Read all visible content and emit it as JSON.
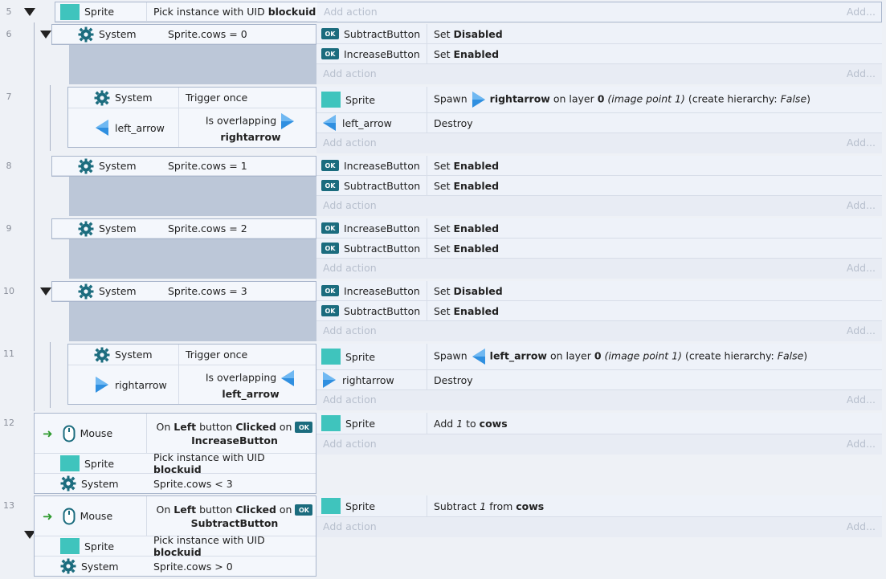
{
  "strings": {
    "add_action": "Add action",
    "add": "Add...",
    "sprite": "Sprite",
    "system": "System",
    "mouse": "Mouse",
    "left_arrow": "left_arrow",
    "rightarrow": "rightarrow",
    "subtract_button": "SubtractButton",
    "increase_button": "IncreaseButton",
    "pick_uid": "Pick instance with UID",
    "blockuid": "blockuid",
    "set": "Set",
    "disabled": "Disabled",
    "enabled": "Enabled",
    "trigger_once": "Trigger once",
    "is_overlapping": "Is overlapping",
    "spawn": "Spawn",
    "on_layer": "on layer",
    "layer_0": "0",
    "image_point": "(image point 1)",
    "create_hierarchy": "(create hierarchy:",
    "false_val": "False",
    "close_paren": ")",
    "destroy": "Destroy",
    "cows_eq_0": "Sprite.cows = 0",
    "cows_eq_1": "Sprite.cows = 1",
    "cows_eq_2": "Sprite.cows = 2",
    "cows_eq_3": "Sprite.cows = 3",
    "cows_lt_3": "Sprite.cows < 3",
    "cows_gt_0": "Sprite.cows > 0",
    "on": "On",
    "left": "Left",
    "button_word": "button",
    "clicked": "Clicked",
    "on_word": "on",
    "add_word": "Add",
    "one": "1",
    "to": "to",
    "from": "from",
    "cows": "cows",
    "subtract_word": "Subtract",
    "ok": "OK"
  },
  "row_numbers": [
    "5",
    "6",
    "7",
    "8",
    "9",
    "10",
    "11",
    "12",
    "13"
  ],
  "colors": {
    "sprite": "#3fc4bd",
    "system_gear": "#1b6c7e",
    "arrow": "#2f8fe0",
    "mouse_arrow": "#2e9a2e"
  }
}
